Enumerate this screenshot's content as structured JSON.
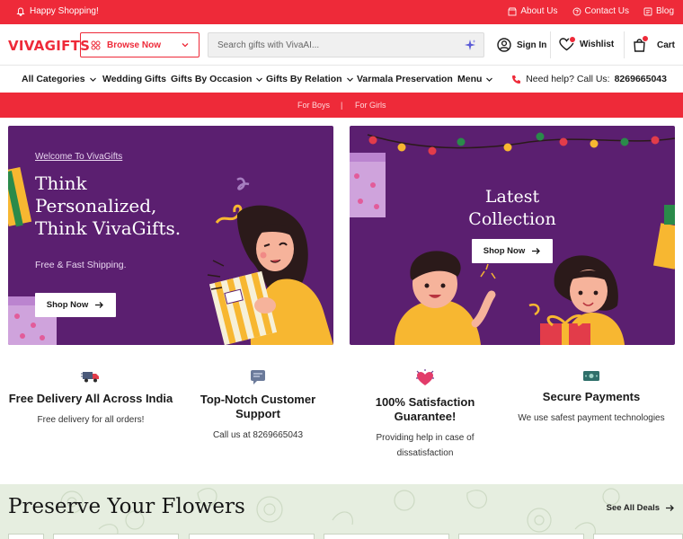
{
  "topbar": {
    "greeting": "Happy Shopping!",
    "links": [
      "About Us",
      "Contact Us",
      "Blog"
    ]
  },
  "header": {
    "logo": "VIVAGIFTS",
    "browse_label": "Browse Now",
    "search_placeholder": "Search gifts with VivaAI...",
    "signin": "Sign In",
    "wishlist": "Wishlist",
    "cart": "Cart"
  },
  "nav": {
    "items": [
      "All Categories",
      "Wedding Gifts",
      "Gifts By Occasion",
      "Gifts By Relation",
      "Varmala Preservation",
      "Menu"
    ],
    "help_prefix": "Need help? Call Us:",
    "help_phone": "8269665043"
  },
  "substrip": {
    "links": [
      "For Boys",
      "For Girls"
    ],
    "separator": "|"
  },
  "banner1": {
    "welcome": "Welcome To VivaGifts",
    "headline": "Think Personalized, Think VivaGifts.",
    "sub": "Free & Fast Shipping.",
    "button": "Shop Now"
  },
  "banner2": {
    "title": "Latest Collection",
    "button": "Shop Now"
  },
  "features": [
    {
      "icon": "delivery-truck-icon",
      "title": "Free Delivery All Across India",
      "desc": "Free delivery for all orders!"
    },
    {
      "icon": "chat-support-icon",
      "title": "Top-Notch Customer Support",
      "desc": "Call us at 8269665043"
    },
    {
      "icon": "heart-satisfaction-icon",
      "title": "100% Satisfaction Guarantee!",
      "desc": "Providing help in case of dissatisfaction"
    },
    {
      "icon": "secure-payment-icon",
      "title": "Secure Payments",
      "desc": "We use safest payment technologies"
    }
  ],
  "preserve": {
    "title": "Preserve Your Flowers",
    "see_all": "See All Deals"
  },
  "colors": {
    "brand_red": "#ee2a39",
    "banner_purple": "#5b1f70",
    "accent_yellow": "#f7b731"
  }
}
